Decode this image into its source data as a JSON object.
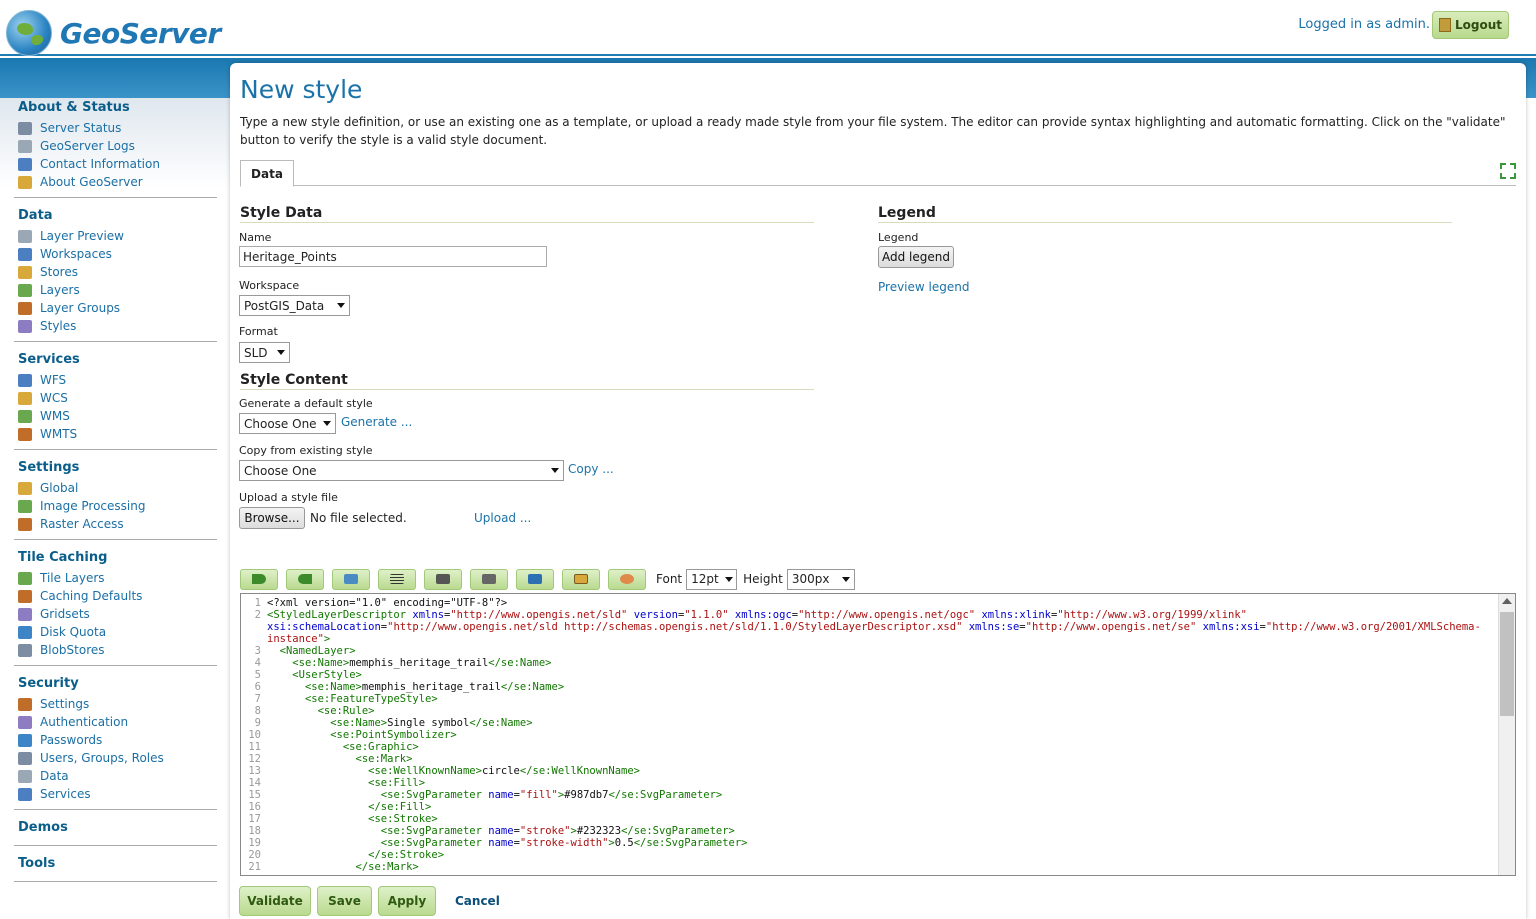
{
  "header": {
    "logo_text": "GeoServer",
    "login_text": "Logged in as admin.",
    "logout_label": "Logout"
  },
  "sidebar": {
    "sections": [
      {
        "title": "About & Status",
        "items": [
          "Server Status",
          "GeoServer Logs",
          "Contact Information",
          "About GeoServer"
        ]
      },
      {
        "title": "Data",
        "items": [
          "Layer Preview",
          "Workspaces",
          "Stores",
          "Layers",
          "Layer Groups",
          "Styles"
        ]
      },
      {
        "title": "Services",
        "items": [
          "WFS",
          "WCS",
          "WMS",
          "WMTS"
        ]
      },
      {
        "title": "Settings",
        "items": [
          "Global",
          "Image Processing",
          "Raster Access"
        ]
      },
      {
        "title": "Tile Caching",
        "items": [
          "Tile Layers",
          "Caching Defaults",
          "Gridsets",
          "Disk Quota",
          "BlobStores"
        ]
      },
      {
        "title": "Security",
        "items": [
          "Settings",
          "Authentication",
          "Passwords",
          "Users, Groups, Roles",
          "Data",
          "Services"
        ]
      },
      {
        "title": "Demos",
        "items": []
      },
      {
        "title": "Tools",
        "items": []
      }
    ]
  },
  "page": {
    "title": "New style",
    "description": "Type a new style definition, or use an existing one as a template, or upload a ready made style from your file system. The editor can provide syntax highlighting and automatic formatting. Click on the \"validate\" button to verify the style is a valid style document.",
    "tab_label": "Data"
  },
  "style_data": {
    "heading": "Style Data",
    "name_label": "Name",
    "name_value": "Heritage_Points",
    "workspace_label": "Workspace",
    "workspace_value": "PostGIS_Data",
    "format_label": "Format",
    "format_value": "SLD"
  },
  "style_content": {
    "heading": "Style Content",
    "generate_label": "Generate a default style",
    "generate_value": "Choose One",
    "generate_link": "Generate ...",
    "copy_label": "Copy from existing style",
    "copy_value": "Choose One",
    "copy_link": "Copy ...",
    "upload_label": "Upload a style file",
    "browse_label": "Browse...",
    "no_file_text": "No file selected.",
    "upload_link": "Upload ..."
  },
  "legend": {
    "heading": "Legend",
    "label": "Legend",
    "add_button": "Add legend",
    "preview_link": "Preview legend"
  },
  "toolbar": {
    "font_label": "Font",
    "font_value": "12pt",
    "height_label": "Height",
    "height_value": "300px"
  },
  "editor": {
    "lines": [
      {
        "n": "1",
        "html": "&lt;?xml version=\"1.0\" encoding=\"UTF-8\"?&gt;"
      },
      {
        "n": "2",
        "html": "<span class='tag'>&lt;StyledLayerDescriptor</span> <span class='atn'>xmlns</span>=<span class='atv'>\"http://www.opengis.net/sld\"</span> <span class='atn'>version</span>=<span class='atv'>\"1.1.0\"</span> <span class='atn'>xmlns:ogc</span>=<span class='atv'>\"http://www.opengis.net/ogc\"</span> <span class='atn'>xmlns:xlink</span>=<span class='atv'>\"http://www.w3.org/1999/xlink\"</span> <span class='atn'>xsi:schemaLocation</span>=<span class='atv'>\"http://www.opengis.net/sld http://schemas.opengis.net/sld/1.1.0/StyledLayerDescriptor.xsd\"</span> <span class='atn'>xmlns:se</span>=<span class='atv'>\"http://www.opengis.net/se\"</span> <span class='atn'>xmlns:xsi</span>=<span class='atv'>\"http://www.w3.org/2001/XMLSchema-instance\"</span><span class='tag'>&gt;</span>"
      },
      {
        "n": "3",
        "html": "  <span class='tag'>&lt;NamedLayer&gt;</span>"
      },
      {
        "n": "4",
        "html": "    <span class='tag'>&lt;se:Name&gt;</span>memphis_heritage_trail<span class='tag'>&lt;/se:Name&gt;</span>"
      },
      {
        "n": "5",
        "html": "    <span class='tag'>&lt;UserStyle&gt;</span>"
      },
      {
        "n": "6",
        "html": "      <span class='tag'>&lt;se:Name&gt;</span>memphis_heritage_trail<span class='tag'>&lt;/se:Name&gt;</span>"
      },
      {
        "n": "7",
        "html": "      <span class='tag'>&lt;se:FeatureTypeStyle&gt;</span>"
      },
      {
        "n": "8",
        "html": "        <span class='tag'>&lt;se:Rule&gt;</span>"
      },
      {
        "n": "9",
        "html": "          <span class='tag'>&lt;se:Name&gt;</span>Single symbol<span class='tag'>&lt;/se:Name&gt;</span>"
      },
      {
        "n": "10",
        "html": "          <span class='tag'>&lt;se:PointSymbolizer&gt;</span>"
      },
      {
        "n": "11",
        "html": "            <span class='tag'>&lt;se:Graphic&gt;</span>"
      },
      {
        "n": "12",
        "html": "              <span class='tag'>&lt;se:Mark&gt;</span>"
      },
      {
        "n": "13",
        "html": "                <span class='tag'>&lt;se:WellKnownName&gt;</span>circle<span class='tag'>&lt;/se:WellKnownName&gt;</span>"
      },
      {
        "n": "14",
        "html": "                <span class='tag'>&lt;se:Fill&gt;</span>"
      },
      {
        "n": "15",
        "html": "                  <span class='tag'>&lt;se:SvgParameter</span> <span class='atn'>name</span>=<span class='atv'>\"fill\"</span><span class='tag'>&gt;</span>#987db7<span class='tag'>&lt;/se:SvgParameter&gt;</span>"
      },
      {
        "n": "16",
        "html": "                <span class='tag'>&lt;/se:Fill&gt;</span>"
      },
      {
        "n": "17",
        "html": "                <span class='tag'>&lt;se:Stroke&gt;</span>"
      },
      {
        "n": "18",
        "html": "                  <span class='tag'>&lt;se:SvgParameter</span> <span class='atn'>name</span>=<span class='atv'>\"stroke\"</span><span class='tag'>&gt;</span>#232323<span class='tag'>&lt;/se:SvgParameter&gt;</span>"
      },
      {
        "n": "19",
        "html": "                  <span class='tag'>&lt;se:SvgParameter</span> <span class='atn'>name</span>=<span class='atv'>\"stroke-width\"</span><span class='tag'>&gt;</span>0.5<span class='tag'>&lt;/se:SvgParameter&gt;</span>"
      },
      {
        "n": "20",
        "html": "                <span class='tag'>&lt;/se:Stroke&gt;</span>"
      },
      {
        "n": "21",
        "html": "              <span class='tag'>&lt;/se:Mark&gt;</span>"
      }
    ]
  },
  "actions": {
    "validate": "Validate",
    "save": "Save",
    "apply": "Apply",
    "cancel": "Cancel"
  },
  "colors": {
    "accent": "#1b72a8",
    "band": "#1a78b0",
    "button_green": "#b9da8f"
  }
}
